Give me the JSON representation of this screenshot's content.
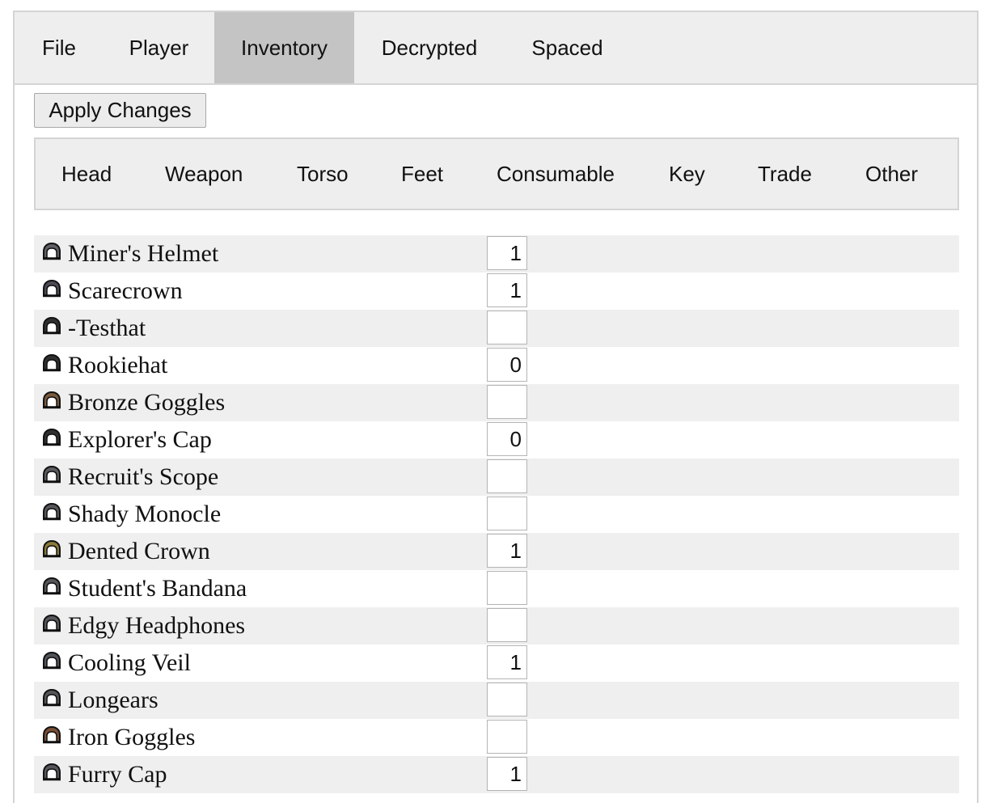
{
  "main_tabs": [
    {
      "label": "File",
      "active": false
    },
    {
      "label": "Player",
      "active": false
    },
    {
      "label": "Inventory",
      "active": true
    },
    {
      "label": "Decrypted",
      "active": false
    },
    {
      "label": "Spaced",
      "active": false
    }
  ],
  "apply_button": {
    "label": "Apply Changes"
  },
  "category_tabs": [
    "Head",
    "Weapon",
    "Torso",
    "Feet",
    "Consumable",
    "Key",
    "Trade",
    "Other"
  ],
  "items": [
    {
      "name": "Miner's Helmet",
      "quantity": "1",
      "icon": "head-gear-icon",
      "tint": "#5f6166"
    },
    {
      "name": "Scarecrown",
      "quantity": "1",
      "icon": "head-gear-icon",
      "tint": "#4e4a55"
    },
    {
      "name": "-Testhat",
      "quantity": "",
      "icon": "head-gear-icon",
      "tint": "#2f2f2f"
    },
    {
      "name": "Rookiehat",
      "quantity": "0",
      "icon": "head-gear-icon",
      "tint": "#2f2f2f"
    },
    {
      "name": "Bronze Goggles",
      "quantity": "",
      "icon": "head-gear-icon",
      "tint": "#7a5a3c"
    },
    {
      "name": "Explorer's Cap",
      "quantity": "0",
      "icon": "head-gear-icon",
      "tint": "#2f2f2f"
    },
    {
      "name": "Recruit's Scope",
      "quantity": "",
      "icon": "head-gear-icon",
      "tint": "#5a5c60"
    },
    {
      "name": "Shady Monocle",
      "quantity": "",
      "icon": "head-gear-icon",
      "tint": "#55575b"
    },
    {
      "name": "Dented Crown",
      "quantity": "1",
      "icon": "head-gear-icon",
      "tint": "#8a7a3a"
    },
    {
      "name": "Student's Bandana",
      "quantity": "",
      "icon": "head-gear-icon",
      "tint": "#55575b"
    },
    {
      "name": "Edgy Headphones",
      "quantity": "",
      "icon": "head-gear-icon",
      "tint": "#55575b"
    },
    {
      "name": "Cooling Veil",
      "quantity": "1",
      "icon": "head-gear-icon",
      "tint": "#505358"
    },
    {
      "name": "Longears",
      "quantity": "",
      "icon": "head-gear-icon",
      "tint": "#55575b"
    },
    {
      "name": "Iron Goggles",
      "quantity": "",
      "icon": "head-gear-icon",
      "tint": "#7a4f35"
    },
    {
      "name": "Furry Cap",
      "quantity": "1",
      "icon": "head-gear-icon",
      "tint": "#55575b"
    }
  ]
}
